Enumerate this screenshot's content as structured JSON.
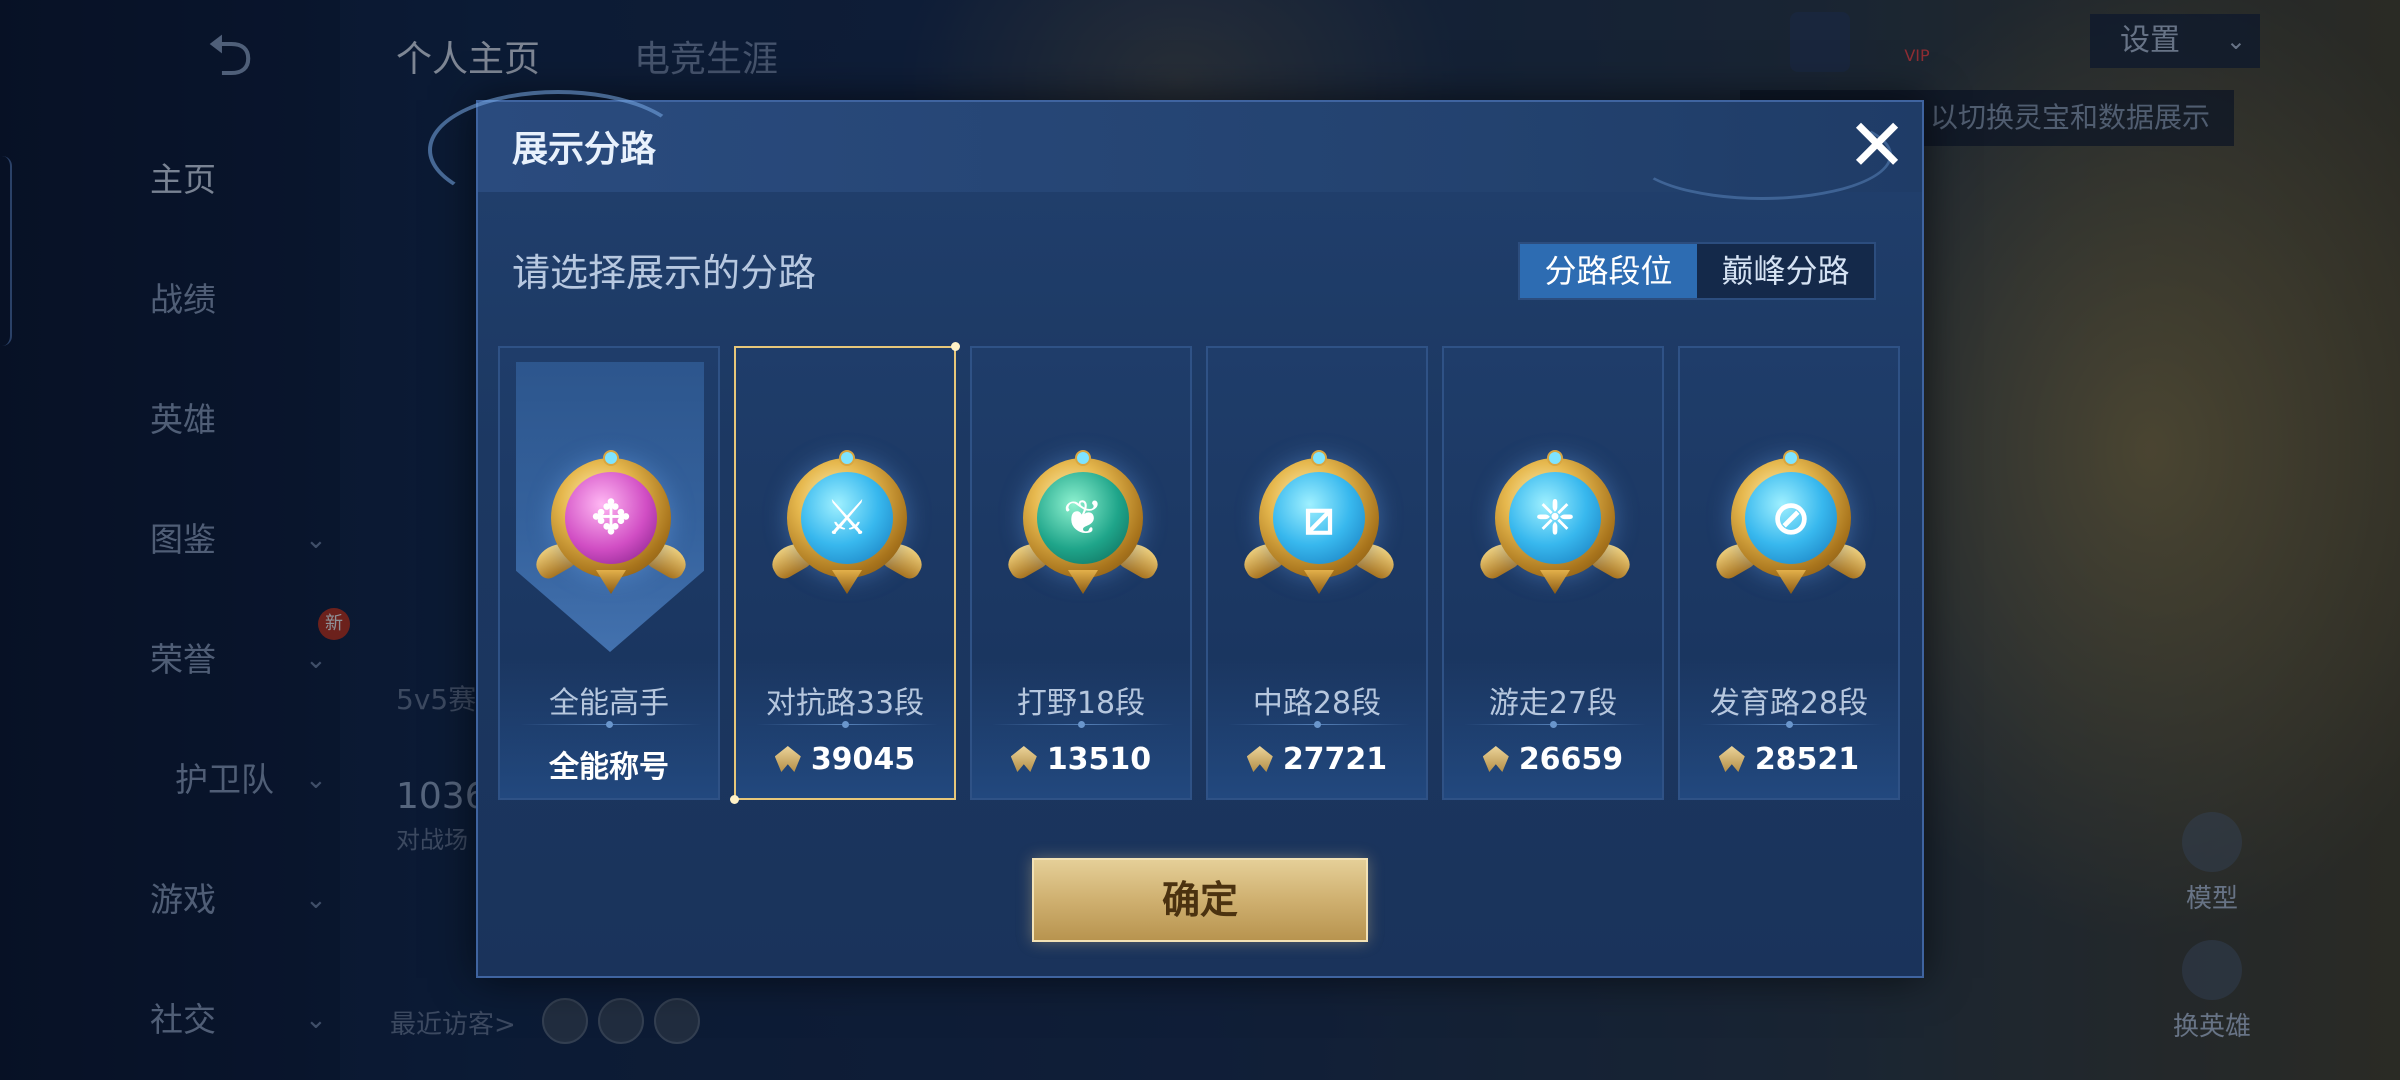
{
  "background": {
    "sidebar": {
      "items": [
        {
          "label": "主页",
          "active": true
        },
        {
          "label": "战绩"
        },
        {
          "label": "英雄"
        },
        {
          "label": "图鉴",
          "chevron": true
        },
        {
          "label": "荣誉",
          "chevron": true,
          "badge": "新"
        },
        {
          "label": "护卫队",
          "chevron": true
        },
        {
          "label": "游戏",
          "chevron": true
        },
        {
          "label": "社交",
          "chevron": true
        }
      ]
    },
    "tabs": [
      "个人主页",
      "电竞生涯"
    ],
    "settings_label": "设置",
    "vip_label": "VIP",
    "tooltip_text": "以切换灵宝和数据展示",
    "mode_text": "5v5赛",
    "battle_count": "1036",
    "battle_label": "对战场",
    "recent_visitors": "最近访客>",
    "right_buttons": [
      "模型",
      "换英雄"
    ]
  },
  "modal": {
    "title": "展示分路",
    "subtitle": "请选择展示的分路",
    "toggle": {
      "options": [
        "分路段位",
        "巅峰分路"
      ],
      "active_index": 0
    },
    "cards": [
      {
        "name": "全能高手",
        "value": "全能称号",
        "emblem": "all-round-emblem",
        "color": "pink",
        "selected": false
      },
      {
        "name": "对抗路33段",
        "value": "39045",
        "emblem": "clash-lane-emblem",
        "color": "blue",
        "selected": true
      },
      {
        "name": "打野18段",
        "value": "13510",
        "emblem": "jungle-emblem",
        "color": "green",
        "selected": false
      },
      {
        "name": "中路28段",
        "value": "27721",
        "emblem": "mid-lane-emblem",
        "color": "blue",
        "selected": false
      },
      {
        "name": "游走27段",
        "value": "26659",
        "emblem": "roam-emblem",
        "color": "blue",
        "selected": false
      },
      {
        "name": "发育路28段",
        "value": "28521",
        "emblem": "farm-lane-emblem",
        "color": "blue",
        "selected": false
      }
    ],
    "confirm_label": "确定",
    "close_icon": "close-icon"
  },
  "colors": {
    "modal_bg": "#1c3862",
    "accent_blue": "#2d6cb2",
    "selected_border": "#e7c77a",
    "confirm_gold": "#cfb070"
  }
}
